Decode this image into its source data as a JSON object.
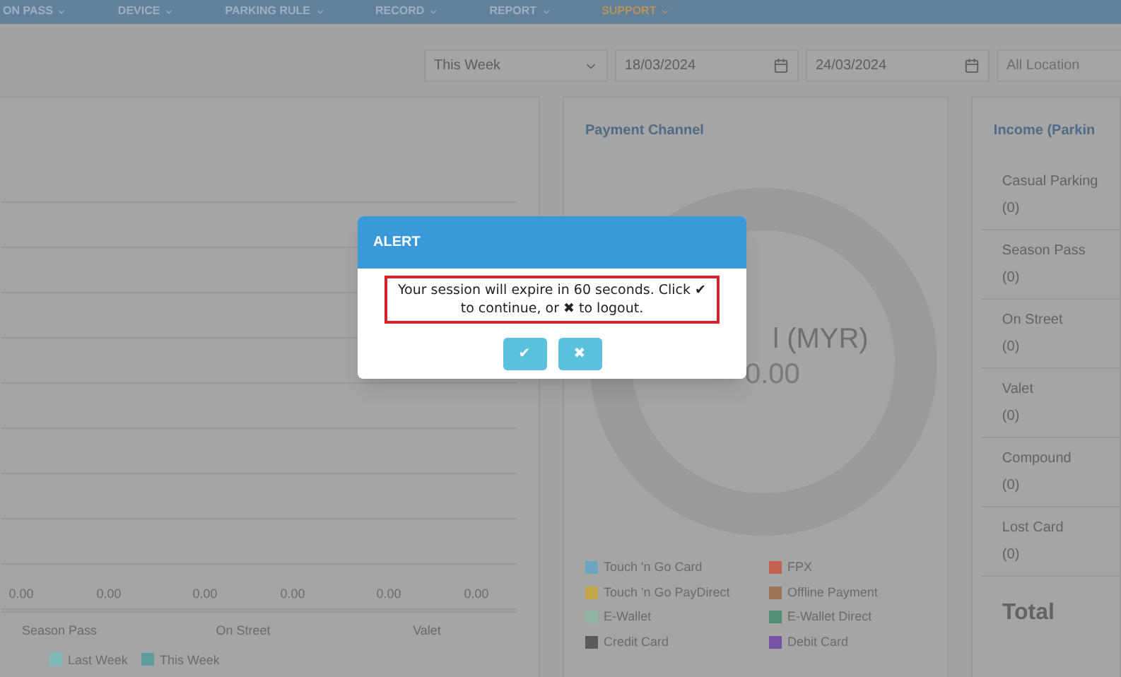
{
  "nav": [
    {
      "label": "ON PASS",
      "selected": false
    },
    {
      "label": "DEVICE",
      "selected": false
    },
    {
      "label": "PARKING RULE",
      "selected": false
    },
    {
      "label": "RECORD",
      "selected": false
    },
    {
      "label": "REPORT",
      "selected": false
    },
    {
      "label": "SUPPORT",
      "selected": true
    }
  ],
  "filters": {
    "period": {
      "value": "This Week"
    },
    "date_from": {
      "value": "18/03/2024"
    },
    "date_to": {
      "value": "24/03/2024"
    },
    "location": {
      "placeholder": "All Location"
    }
  },
  "income_chart": {
    "groups": [
      {
        "label": "Season Pass",
        "values": [
          "0.00",
          "0.00"
        ]
      },
      {
        "label": "On Street",
        "values": [
          "0.00",
          "0.00"
        ]
      },
      {
        "label": "Valet",
        "values": [
          "0.00",
          "0.00"
        ]
      }
    ],
    "legend": [
      {
        "label": "Last Week",
        "color": "#7fb8b8"
      },
      {
        "label": "This Week",
        "color": "#5e9c9e"
      }
    ]
  },
  "payment_channel": {
    "title": "Payment Channel",
    "center_label": "l (MYR)",
    "center_value": "0.00",
    "legend": [
      {
        "label": "Touch 'n Go Card",
        "color": "#6aa6c2"
      },
      {
        "label": "FPX",
        "color": "#c0624f"
      },
      {
        "label": "Touch 'n Go PayDirect",
        "color": "#c2a64a"
      },
      {
        "label": "Offline Payment",
        "color": "#9c7352"
      },
      {
        "label": "E-Wallet",
        "color": "#8fb5a5"
      },
      {
        "label": "E-Wallet Direct",
        "color": "#4f8f73"
      },
      {
        "label": "Credit Card",
        "color": "#5a5a5a"
      },
      {
        "label": "Debit Card",
        "color": "#7552a3"
      }
    ]
  },
  "income_panel": {
    "title": "Income (Parkin",
    "items": [
      {
        "label": "Casual Parking",
        "value": "(0)"
      },
      {
        "label": "Season Pass",
        "value": "(0)"
      },
      {
        "label": "On Street",
        "value": "(0)"
      },
      {
        "label": "Valet",
        "value": "(0)"
      },
      {
        "label": "Compound",
        "value": "(0)"
      },
      {
        "label": "Lost Card",
        "value": "(0)"
      }
    ],
    "total_label": "Total"
  },
  "alert": {
    "title": "ALERT",
    "message": "Your session will expire in 60 seconds. Click ✔ to continue, or ✖ to logout.",
    "buttons": [
      "✔",
      "✖"
    ]
  }
}
